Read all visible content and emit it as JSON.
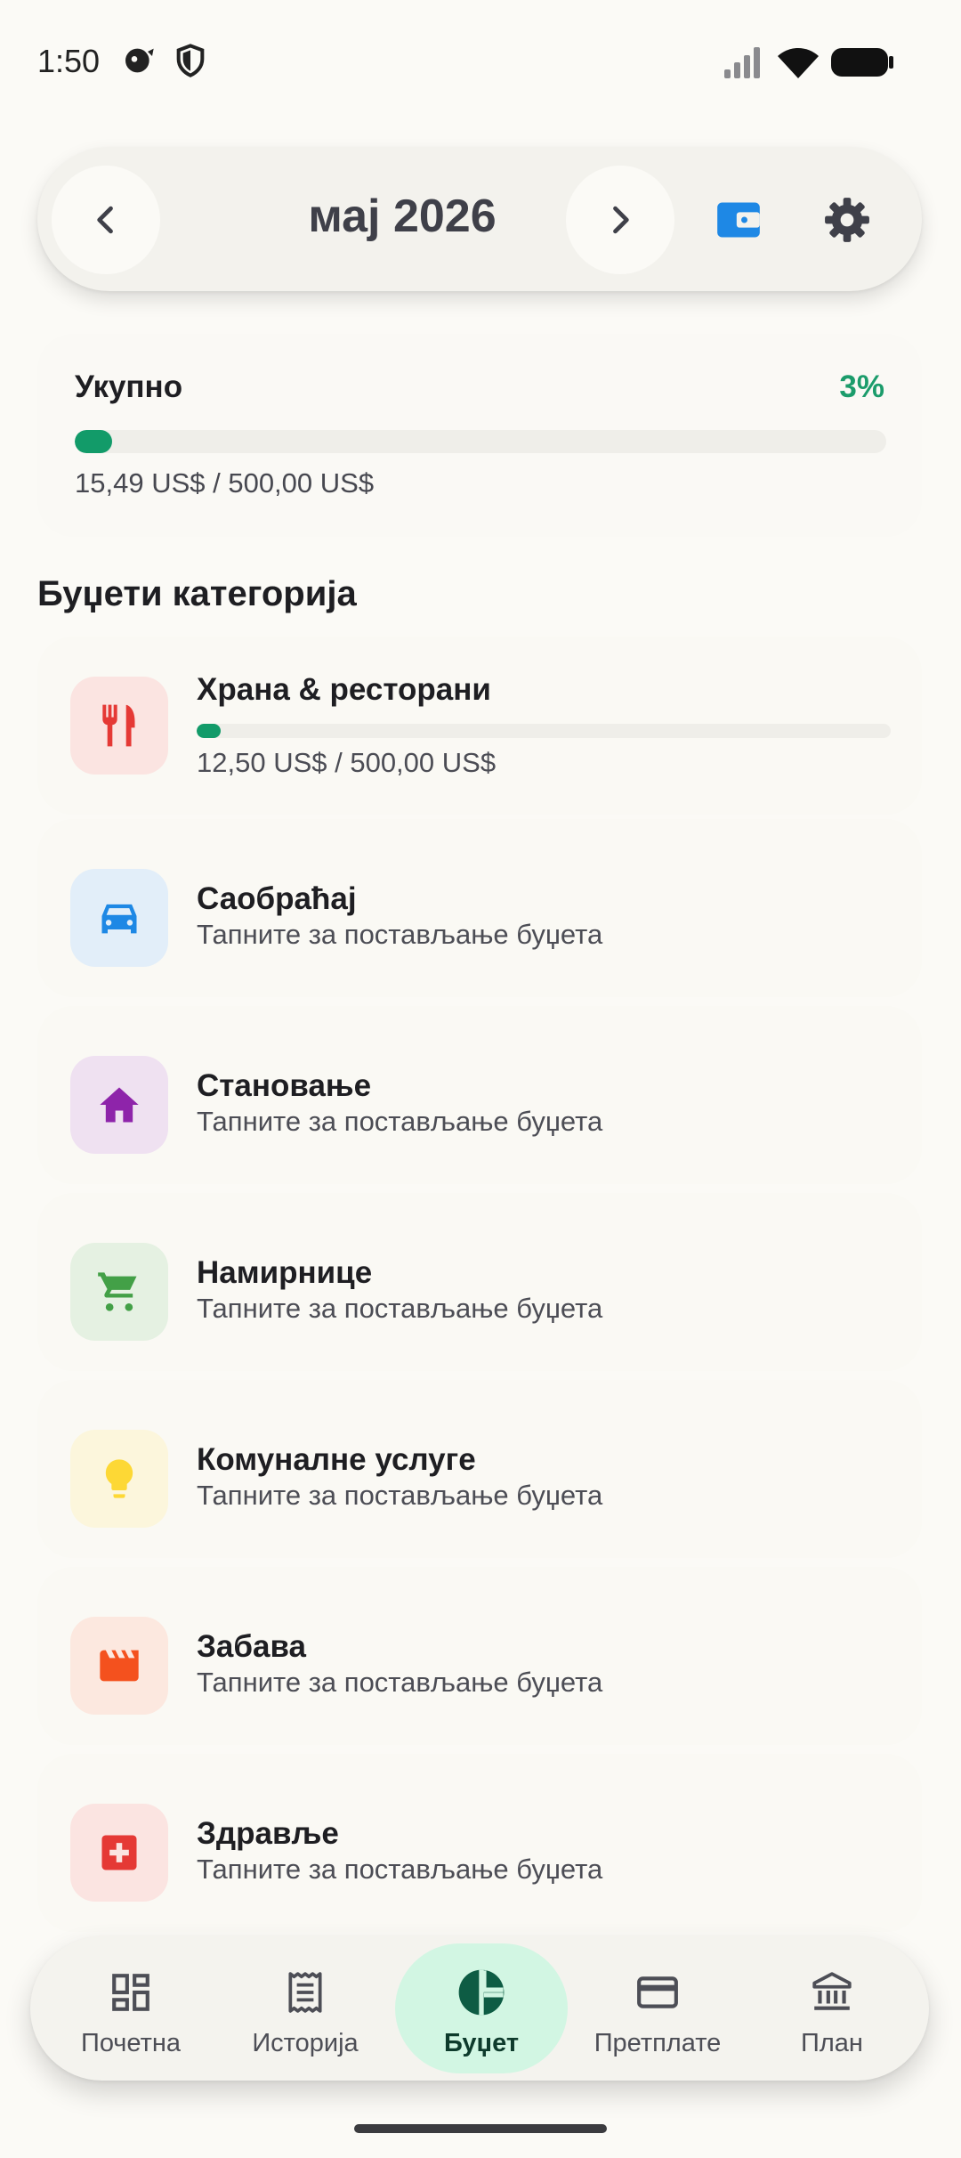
{
  "status_bar": {
    "time": "1:50"
  },
  "header": {
    "month": "мај 2026"
  },
  "total": {
    "label": "Укупно",
    "percent": "3%",
    "amount": "15,49 US$ / 500,00 US$",
    "progress_fraction": 0.031
  },
  "categories_title": "Буџети категорија",
  "categories": [
    {
      "name": "Храна & ресторани",
      "amount": "12,50 US$ / 500,00 US$",
      "progress_fraction": 0.025,
      "icon": "restaurant-icon",
      "color": "#e53935",
      "bg": "#fbe4e1"
    },
    {
      "name": "Саобраћај",
      "subtitle": "Тапните за постављање буџета",
      "icon": "car-icon",
      "color": "#1e88e5",
      "bg": "#e2eef9"
    },
    {
      "name": "Становање",
      "subtitle": "Тапните за постављање буџета",
      "icon": "home-icon",
      "color": "#8e24aa",
      "bg": "#efe1f1"
    },
    {
      "name": "Намирнице",
      "subtitle": "Тапните за постављање буџета",
      "icon": "cart-icon",
      "color": "#43a047",
      "bg": "#e5f1e2"
    },
    {
      "name": "Комуналне услуге",
      "subtitle": "Тапните за постављање буџета",
      "icon": "lightbulb-icon",
      "color": "#fdd835",
      "bg": "#fcf6dc"
    },
    {
      "name": "Забава",
      "subtitle": "Тапните за постављање буџета",
      "icon": "clapperboard-icon",
      "color": "#f4511e",
      "bg": "#fce8df"
    },
    {
      "name": "Здравље",
      "subtitle": "Тапните за постављање буџета",
      "icon": "medical-icon",
      "color": "#e53935",
      "bg": "#fbe4e1"
    }
  ],
  "bottom_nav": [
    {
      "label": "Почетна",
      "icon": "dashboard-icon"
    },
    {
      "label": "Историја",
      "icon": "receipt-icon"
    },
    {
      "label": "Буџет",
      "icon": "pie-chart-icon",
      "active": true
    },
    {
      "label": "Претплате",
      "icon": "credit-card-icon"
    },
    {
      "label": "План",
      "icon": "bank-icon"
    }
  ],
  "colors": {
    "accent": "#129b69",
    "active_nav_bg": "#d2f6e3",
    "wallet_blue": "#1e88e5"
  }
}
